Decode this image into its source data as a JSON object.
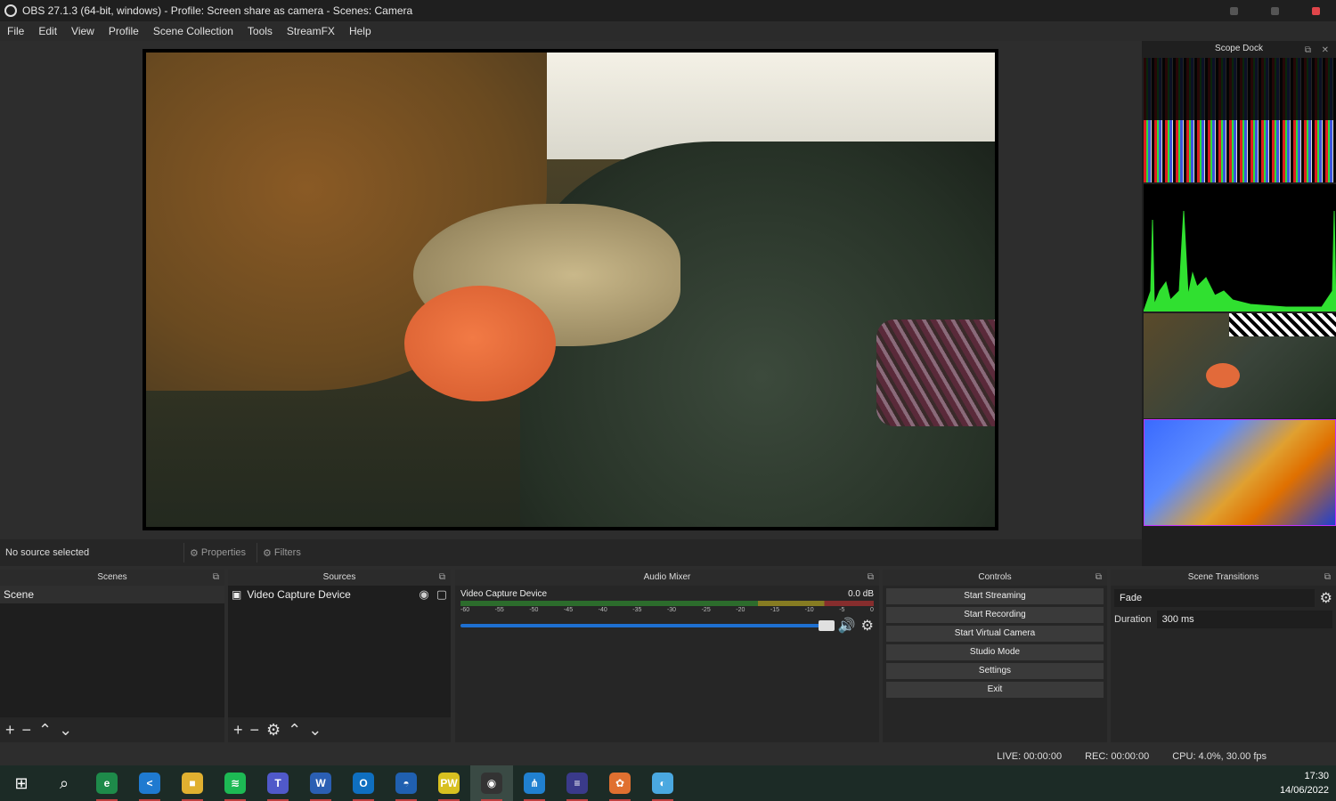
{
  "window": {
    "title": "OBS 27.1.3 (64-bit, windows) - Profile: Screen share as camera - Scenes: Camera"
  },
  "menu": [
    "File",
    "Edit",
    "View",
    "Profile",
    "Scene Collection",
    "Tools",
    "StreamFX",
    "Help"
  ],
  "scope": {
    "title": "Scope Dock"
  },
  "status_row": {
    "no_source": "No source selected",
    "properties": "Properties",
    "filters": "Filters"
  },
  "scenes": {
    "title": "Scenes",
    "items": [
      "Scene"
    ]
  },
  "sources": {
    "title": "Sources",
    "items": [
      "Video Capture Device"
    ]
  },
  "audio": {
    "title": "Audio Mixer",
    "channel": "Video Capture Device",
    "level": "0.0 dB",
    "ticks": [
      "-60",
      "-55",
      "-50",
      "-45",
      "-40",
      "-35",
      "-30",
      "-25",
      "-20",
      "-15",
      "-10",
      "-5",
      "0"
    ]
  },
  "controls": {
    "title": "Controls",
    "buttons": [
      "Start Streaming",
      "Start Recording",
      "Start Virtual Camera",
      "Studio Mode",
      "Settings",
      "Exit"
    ]
  },
  "transitions": {
    "title": "Scene Transitions",
    "selected": "Fade",
    "duration_label": "Duration",
    "duration": "300 ms"
  },
  "status": {
    "live": "LIVE: 00:00:00",
    "rec": "REC: 00:00:00",
    "cpu": "CPU: 4.0%, 30.00 fps"
  },
  "clock": {
    "time": "17:30",
    "date": "14/06/2022"
  },
  "taskbar_apps": [
    {
      "name": "edge-dev-icon",
      "color": "#1e8a4a",
      "glyph": "e"
    },
    {
      "name": "vscode-icon",
      "color": "#1f7ad0",
      "glyph": "<"
    },
    {
      "name": "file-explorer-icon",
      "color": "#e0b030",
      "glyph": "■"
    },
    {
      "name": "spotify-icon",
      "color": "#1db954",
      "glyph": "≋"
    },
    {
      "name": "teams-icon",
      "color": "#5059c9",
      "glyph": "T"
    },
    {
      "name": "word-icon",
      "color": "#2b5fb3",
      "glyph": "W"
    },
    {
      "name": "outlook-icon",
      "color": "#0f6fc0",
      "glyph": "O"
    },
    {
      "name": "app-icon-blue",
      "color": "#2060b0",
      "glyph": "◓"
    },
    {
      "name": "pw-icon",
      "color": "#d8c020",
      "glyph": "PW"
    },
    {
      "name": "obs-icon",
      "color": "#333333",
      "glyph": "◉"
    },
    {
      "name": "network-icon",
      "color": "#2080d0",
      "glyph": "⋔"
    },
    {
      "name": "eclipse-icon",
      "color": "#3a3a8a",
      "glyph": "≡"
    },
    {
      "name": "tool-icon",
      "color": "#e07030",
      "glyph": "✿"
    },
    {
      "name": "app-icon-globe",
      "color": "#4aa8e0",
      "glyph": "◐"
    }
  ]
}
